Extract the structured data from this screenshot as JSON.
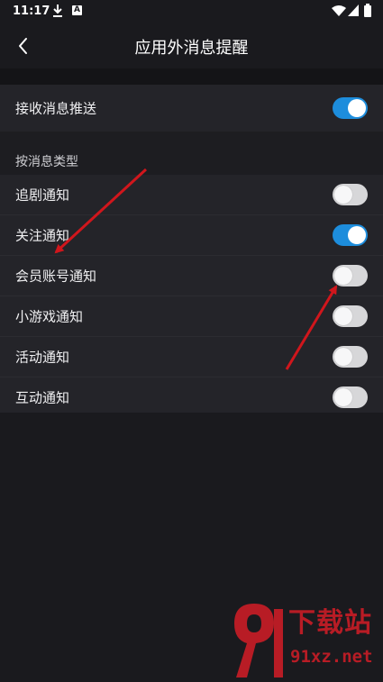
{
  "status_bar": {
    "time": "11:17",
    "a_badge": "A"
  },
  "header": {
    "title": "应用外消息提醒"
  },
  "push": {
    "label": "接收消息推送",
    "enabled": true
  },
  "section": {
    "title": "按消息类型"
  },
  "notification_types": [
    {
      "label": "追剧通知",
      "enabled": false
    },
    {
      "label": "关注通知",
      "enabled": true
    },
    {
      "label": "会员账号通知",
      "enabled": false
    },
    {
      "label": "小游戏通知",
      "enabled": false
    },
    {
      "label": "活动通知",
      "enabled": false
    },
    {
      "label": "互动通知",
      "enabled": false
    }
  ],
  "watermark": {
    "brand": "下载站",
    "domain": "91xz.net"
  },
  "colors": {
    "toggle_on": "#1d8ddc",
    "toggle_off": "#d7d7d9",
    "annotation_arrow": "#d0161c"
  }
}
